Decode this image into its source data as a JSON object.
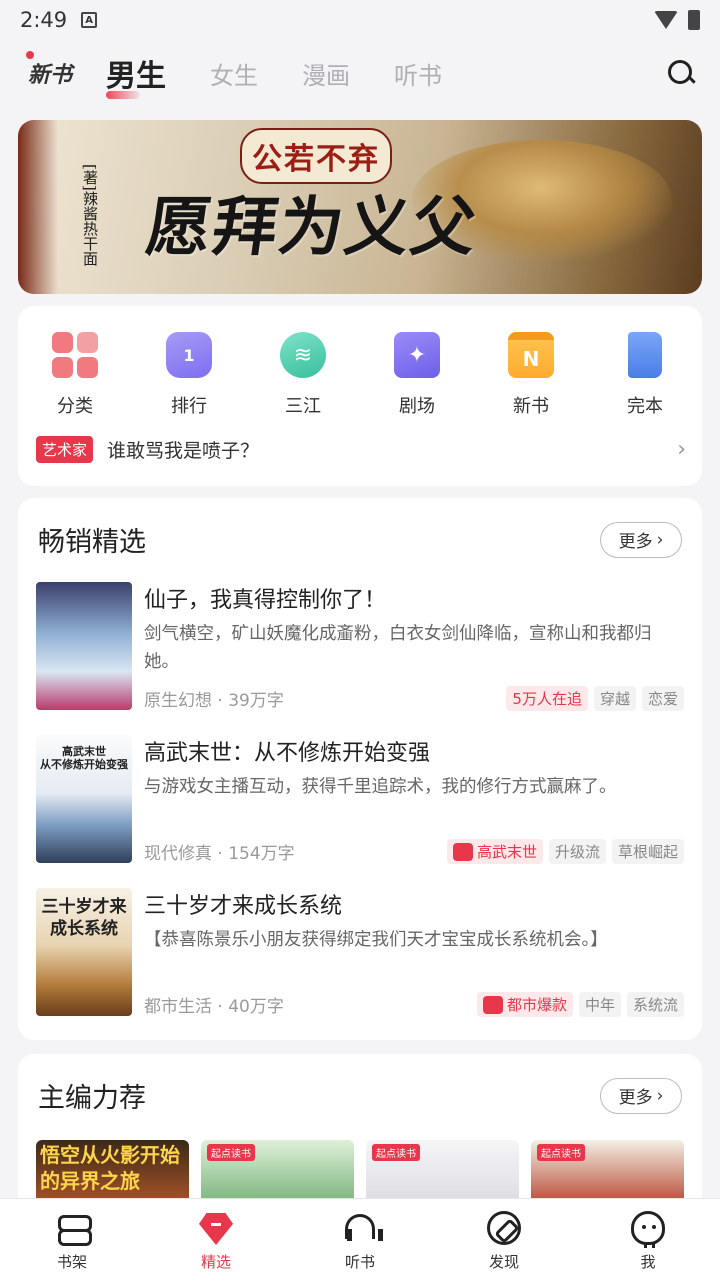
{
  "status_bar": {
    "time": "2:49",
    "notif_icon": "A"
  },
  "top_tabs": {
    "new_label": "新书",
    "tabs": [
      {
        "label": "男生",
        "active": true
      },
      {
        "label": "女生",
        "active": false
      },
      {
        "label": "漫画",
        "active": false
      },
      {
        "label": "听书",
        "active": false
      }
    ]
  },
  "banner": {
    "subtitle": "公若不弃",
    "title": "愿拜为义父",
    "author": "[著]辣酱热干面"
  },
  "quick_entries": [
    {
      "label": "分类",
      "icon": "category-icon"
    },
    {
      "label": "排行",
      "icon": "rank-icon",
      "icon_text": "1"
    },
    {
      "label": "三江",
      "icon": "sanjiang-icon",
      "icon_text": "≋"
    },
    {
      "label": "剧场",
      "icon": "theater-icon",
      "icon_text": "✦"
    },
    {
      "label": "新书",
      "icon": "new-book-icon",
      "icon_text": "N"
    },
    {
      "label": "完本",
      "icon": "finished-icon"
    }
  ],
  "notice": {
    "badge": "艺术家",
    "text": "谁敢骂我是喷子？",
    "arrow": "›"
  },
  "bestsellers": {
    "title": "畅销精选",
    "more_label": "更多",
    "more_arrow": "›",
    "books": [
      {
        "title": "仙子，我真得控制你了！",
        "desc": "剑气横空，矿山妖魔化成齑粉，白衣女剑仙降临，宣称山和我都归她。",
        "genre": "原生幻想",
        "dot": "·",
        "words": "39万字",
        "tags": [
          "5万人在追",
          "穿越",
          "恋爱"
        ],
        "cover_text": "",
        "colors": {
          "hot": "#e8364a"
        }
      },
      {
        "title": "高武末世：从不修炼开始变强",
        "desc": "与游戏女主播互动，获得千里追踪术，我的修行方式赢麻了。",
        "genre": "现代修真",
        "dot": "·",
        "words": "154万字",
        "tags": [
          "高武末世",
          "升级流",
          "草根崛起"
        ],
        "cover_text": "高武末世\n从不修炼开始变强"
      },
      {
        "title": "三十岁才来成长系统",
        "desc": "【恭喜陈景乐小朋友获得绑定我们天才宝宝成长系统机会。】",
        "genre": "都市生活",
        "dot": "·",
        "words": "40万字",
        "tags": [
          "都市爆款",
          "中年",
          "系统流"
        ],
        "cover_text": "三十岁才来\n成长系统"
      }
    ]
  },
  "editor_picks": {
    "title": "主编力荐",
    "more_label": "更多",
    "more_arrow": "›",
    "items": [
      {
        "cover_text": "悟空从火影开始\n的异界之旅"
      },
      {
        "cover_text": "起点读书"
      },
      {
        "cover_text": "起点读书"
      },
      {
        "cover_text": "起点读书"
      }
    ]
  },
  "bottom_nav": [
    {
      "label": "书架",
      "icon": "bookshelf-icon",
      "active": false
    },
    {
      "label": "精选",
      "icon": "featured-icon",
      "active": true
    },
    {
      "label": "听书",
      "icon": "headphones-icon",
      "active": false
    },
    {
      "label": "发现",
      "icon": "compass-icon",
      "active": false
    },
    {
      "label": "我",
      "icon": "profile-icon",
      "active": false
    }
  ],
  "colors": {
    "accent": "#e8364a",
    "background": "#f4f4f6"
  }
}
